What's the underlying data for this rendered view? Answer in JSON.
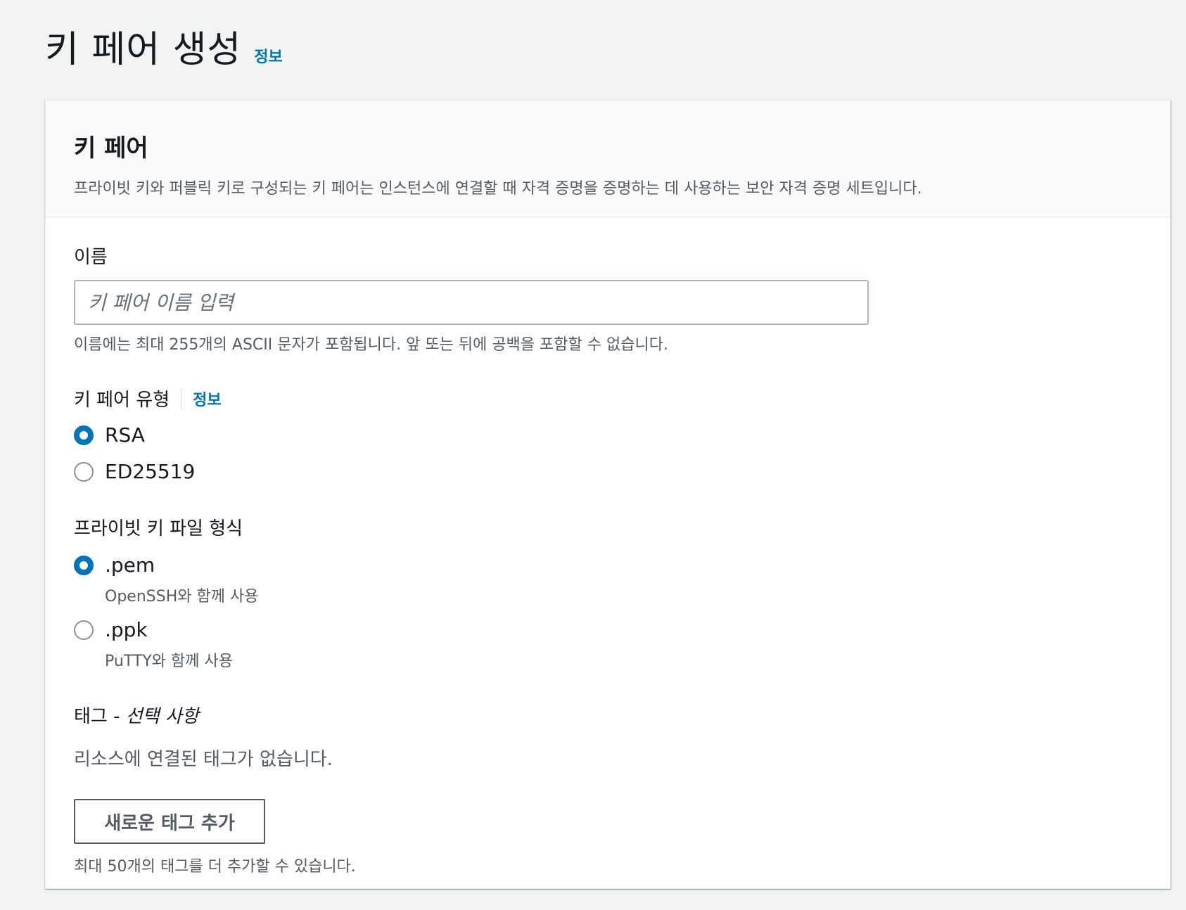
{
  "page": {
    "title": "키 페어 생성",
    "info_label": "정보"
  },
  "panel": {
    "title": "키 페어",
    "description": "프라이빗 키와 퍼블릭 키로 구성되는 키 페어는 인스턴스에 연결할 때 자격 증명을 증명하는 데 사용하는 보안 자격 증명 세트입니다."
  },
  "name_field": {
    "label": "이름",
    "placeholder": "키 페어 이름 입력",
    "value": "",
    "hint": "이름에는 최대 255개의 ASCII 문자가 포함됩니다. 앞 또는 뒤에 공백을 포함할 수 없습니다."
  },
  "key_type": {
    "label": "키 페어 유형",
    "info_label": "정보",
    "options": [
      {
        "label": "RSA",
        "checked": true
      },
      {
        "label": "ED25519",
        "checked": false
      }
    ]
  },
  "file_format": {
    "label": "프라이빗 키 파일 형식",
    "options": [
      {
        "label": ".pem",
        "description": "OpenSSH와 함께 사용",
        "checked": true
      },
      {
        "label": ".ppk",
        "description": "PuTTY와 함께 사용",
        "checked": false
      }
    ]
  },
  "tags": {
    "label_main": "태그 - ",
    "label_optional": "선택 사항",
    "empty_message": "리소스에 연결된 태그가 없습니다.",
    "add_button": "새로운 태그 추가",
    "limit_hint": "최대 50개의 태그를 더 추가할 수 있습니다."
  },
  "colors": {
    "accent": "#0073bb",
    "background": "#f2f3f3",
    "text": "#16191f",
    "secondary_text": "#545b64"
  }
}
